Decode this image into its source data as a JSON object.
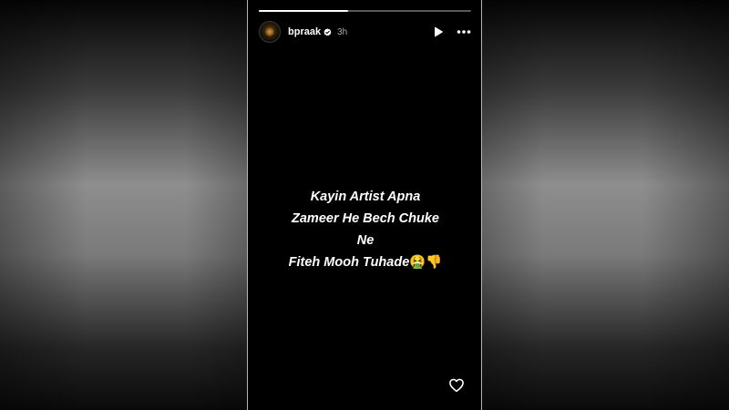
{
  "story": {
    "progress": 0.42,
    "username": "bpraak",
    "verified": true,
    "time_ago": "3h",
    "message_lines": [
      "Kayin Artist Apna",
      "Zameer He Bech Chuke",
      "Ne",
      "Fiteh Mooh Tuhade"
    ],
    "emojis": "🤮👎",
    "icons": {
      "verified": "verified-badge-icon",
      "play": "play-icon",
      "more": "more-options-icon",
      "like": "heart-icon"
    }
  }
}
